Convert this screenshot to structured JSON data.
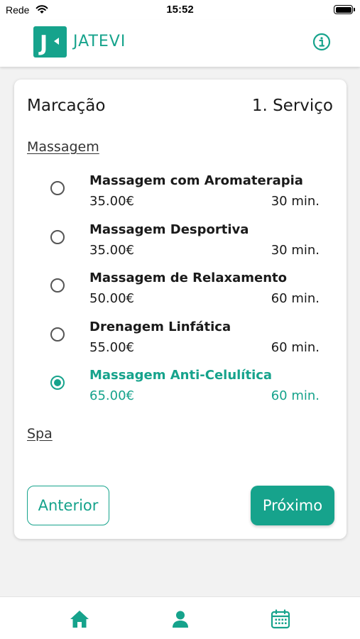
{
  "status_bar": {
    "carrier": "Rede",
    "time": "15:52"
  },
  "header": {
    "app_name": "JATEVI",
    "logo_letter": "J"
  },
  "booking": {
    "title": "Marcação",
    "step": "1. Serviço",
    "categories": [
      {
        "name": "Massagem",
        "services": [
          {
            "name": "Massagem com Aromaterapia",
            "price": "35.00€",
            "duration": "30 min.",
            "selected": false
          },
          {
            "name": "Massagem Desportiva",
            "price": "35.00€",
            "duration": "30 min.",
            "selected": false
          },
          {
            "name": "Massagem de Relaxamento",
            "price": "50.00€",
            "duration": "60 min.",
            "selected": false
          },
          {
            "name": "Drenagem Linfática",
            "price": "55.00€",
            "duration": "60 min.",
            "selected": false
          },
          {
            "name": "Massagem Anti-Celulítica",
            "price": "65.00€",
            "duration": "60 min.",
            "selected": true
          }
        ]
      },
      {
        "name": "Spa",
        "services": []
      }
    ],
    "prev_label": "Anterior",
    "next_label": "Próximo"
  },
  "tabs": [
    {
      "icon": "home-icon"
    },
    {
      "icon": "user-icon"
    },
    {
      "icon": "calendar-icon"
    }
  ],
  "colors": {
    "accent": "#16a38c",
    "text": "#1a1a1a",
    "background": "#f2f2f2"
  }
}
